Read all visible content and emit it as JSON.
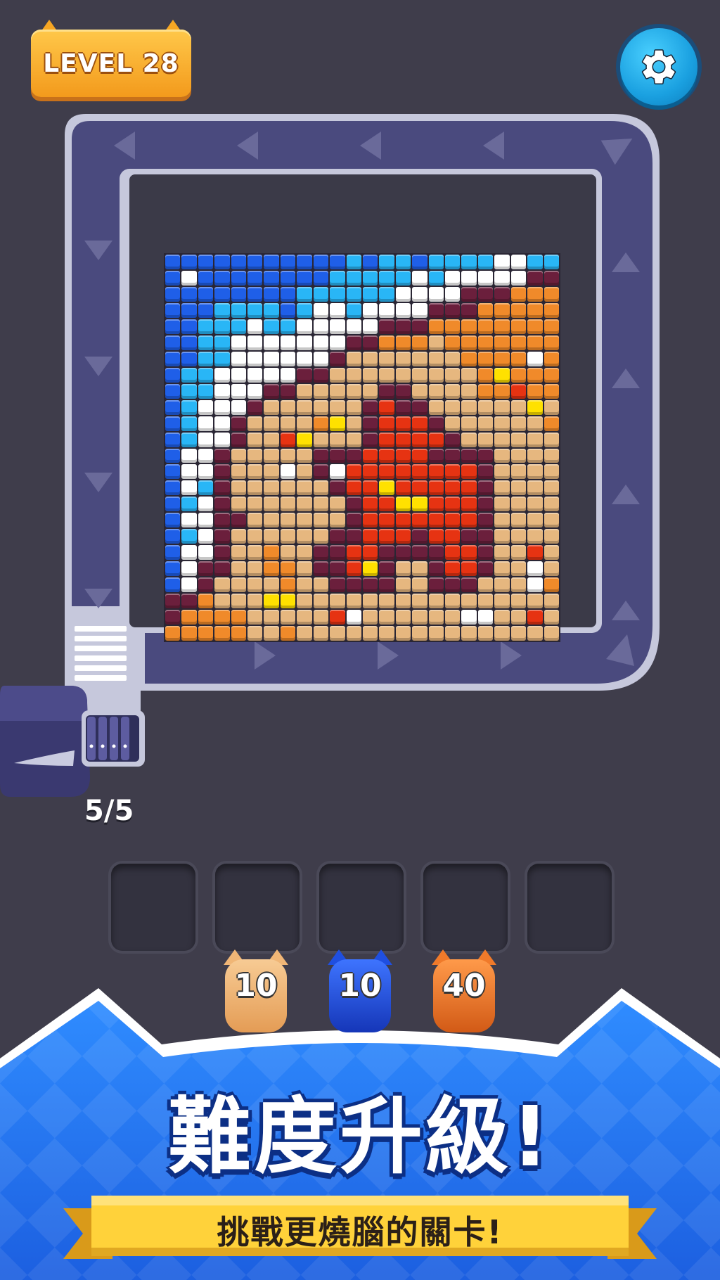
{
  "level": {
    "label": "LEVEL 28"
  },
  "settings": {
    "icon": "gear-icon"
  },
  "launcher": {
    "ammo": "5/5"
  },
  "slots": [
    {},
    {},
    {},
    {},
    {}
  ],
  "cats": [
    {
      "value": "10",
      "color": "#f0b676"
    },
    {
      "value": "10",
      "color": "#1f4fe0"
    },
    {
      "value": "40",
      "color": "#f07a2a"
    }
  ],
  "banner": {
    "title": "難度升級!",
    "subtitle": "挑戰更燒腦的關卡!"
  },
  "palette": {
    "W": "#ffffff",
    "B": "#1f5fe8",
    "L": "#29b6f6",
    "T": "#e6b77f",
    "O": "#f08a2a",
    "D": "#6b1f3c",
    "R": "#e63312",
    "Y": "#ffe100",
    "K": "#3a2a2a"
  },
  "pixel_art": [
    "BBBBBBBBBBBLBLLBLLLLWWLL",
    "BWBBBBBBBBLLLLLWLWWWWWDD",
    "BBBBBBBBLLLLLLWWWWDDDOOO",
    "BBBLLLLBLWWLWWWWDDDOOOOO",
    "BBLLLWLLWWWWWDDDOOOOOOOO",
    "BBLLWWWWWWWDDOOOTOOOOOOO",
    "BBLLWWWWWWDTTTTTTTOOOOWO",
    "BLLWWWWWDDTTTTTTTTTOYOOO",
    "BLLWWWDDTTTTTDDTTTTOOROO",
    "BLWWWDTTTTTTDRDDTTTTTTYT",
    "BLWWDTTTTOYTDRRRDTTTTTTO",
    "BLWWDTTRYTTTDRRRRDTTTTTT",
    "BWWDTTTTTDDDRRRRDDDDTTTT",
    "BWWDTTTWTDWRRRRRRRRDTTTT",
    "BWLDTTTTTTDRRYRRRRRDTTTT",
    "BLWDTTTTTTTDRRYYRRRDTTTT",
    "BWWDDTTTTTTDRRRRRRRDTTTT",
    "BLWDTTTTTTDDRRRDRRDDTTTT",
    "BWWDTTOTTDDRRDDDDRRDTTRT",
    "BWDDTTOOTDDRYDTTDRRDTTWT",
    "BWDTTTTOTTDDDDTTDDDTTTWO",
    "DDOTTTYYTTTTTTTTTTTTTTTT",
    "DOOOOTTTTTRWTTTTTTWWTTRT",
    "OOOOOTTOTTTTTTTTTTTTTTTT"
  ]
}
